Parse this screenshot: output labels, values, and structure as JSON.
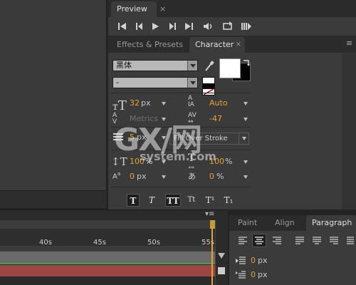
{
  "preview": {
    "tab_label": "Preview",
    "close": "×"
  },
  "character_tabs": [
    {
      "label": "Effects & Presets"
    },
    {
      "label": "Character",
      "close": "×"
    }
  ],
  "character": {
    "font_family": "黑体",
    "font_style": "-",
    "font_size": {
      "value": "32",
      "unit": "px"
    },
    "leading": {
      "value": "Auto"
    },
    "kerning": {
      "value": "Metrics"
    },
    "tracking": {
      "value": "-47"
    },
    "stroke_width": {
      "value": "5",
      "unit": "px"
    },
    "stroke_type": "Fill Over Stroke",
    "vertical_scale": {
      "value": "100",
      "unit": "%"
    },
    "horizontal_scale": {
      "value": "100",
      "unit": "%"
    },
    "baseline_shift": {
      "value": "0",
      "unit": "px"
    },
    "tsume": {
      "value": "0",
      "unit": "%"
    },
    "format_buttons": [
      {
        "label": "T",
        "style": "faux-bold"
      },
      {
        "label": "T",
        "style": "faux-italic"
      },
      {
        "label": "TT",
        "style": "all-caps"
      },
      {
        "label": "Tt",
        "style": "small-caps"
      },
      {
        "label": "T¹",
        "style": "superscript"
      },
      {
        "label": "T₁",
        "style": "subscript"
      }
    ],
    "fill_color": "#ffffff",
    "stroke_color": "#000000"
  },
  "timeline": {
    "ruler_labels": [
      "40s",
      "45s",
      "50s",
      "55s"
    ],
    "colors": {
      "green_track": "#3fa23f",
      "red_track": "#a04a4a",
      "playhead": "#e8a32c"
    }
  },
  "paragraph_panel": {
    "tabs": [
      {
        "label": "Paint"
      },
      {
        "label": "Align"
      },
      {
        "label": "Paragraph"
      }
    ],
    "indent_left": {
      "value": "0",
      "unit": "px"
    },
    "indent_first": {
      "value": "0",
      "unit": "px"
    }
  },
  "watermark": {
    "brand": "GX/网",
    "domain": "system.com"
  }
}
